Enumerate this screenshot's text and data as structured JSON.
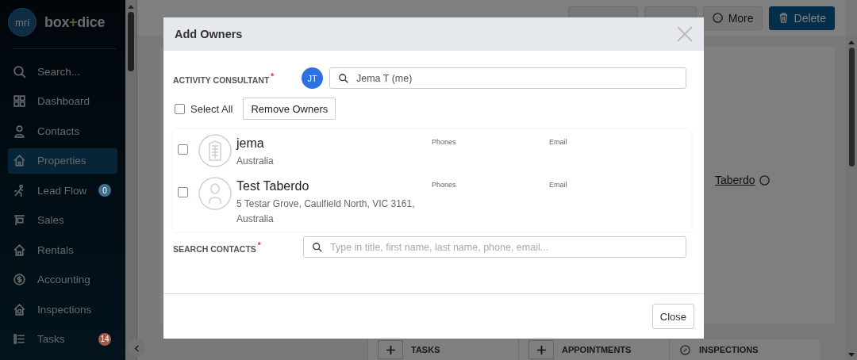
{
  "sidebar": {
    "logo": {
      "mark": "mri",
      "name_parts": [
        "box",
        "+",
        "dice"
      ]
    },
    "items": [
      {
        "label": "Search...",
        "selected": false
      },
      {
        "label": "Dashboard",
        "selected": false
      },
      {
        "label": "Contacts",
        "selected": false
      },
      {
        "label": "Properties",
        "selected": true
      },
      {
        "label": "Lead Flow",
        "selected": false,
        "badge": "0",
        "color": "#40708f"
      },
      {
        "label": "Sales",
        "selected": false
      },
      {
        "label": "Rentals",
        "selected": false
      },
      {
        "label": "Accounting",
        "selected": false
      },
      {
        "label": "Inspections",
        "selected": false
      },
      {
        "label": "Tasks",
        "selected": false,
        "badge": "14",
        "color": "#a35a4c"
      }
    ]
  },
  "page": {
    "actions": [
      {
        "kind": "covered"
      },
      {
        "kind": "covered"
      },
      {
        "label": "More",
        "kind": "outline"
      },
      {
        "label": "Delete",
        "kind": "primary"
      }
    ],
    "owner_link": "Taberdo",
    "sections": [
      {
        "label": "TASKS",
        "kind": "add"
      },
      {
        "label": "APPOINTMENTS",
        "kind": "add"
      },
      {
        "label": "INSPECTIONS",
        "kind": "icon"
      }
    ]
  },
  "dialog": {
    "title": "Add Owners",
    "consultant": {
      "label": "ACTIVITY CONSULTANT",
      "required_mark": "*",
      "initials": "JT",
      "value": "Jema T (me)"
    },
    "select_all": {
      "label": "Select All",
      "checked": false
    },
    "remove_button": "Remove Owners",
    "contacts": [
      {
        "kind": "company",
        "name": "jema",
        "address": "Australia",
        "checked": false,
        "phones_label": "Phones",
        "email_label": "Email"
      },
      {
        "kind": "person",
        "name": "Test Taberdo",
        "address": "5 Testar Grove, Caulfield North, VIC 3161, Australia",
        "checked": false,
        "phones_label": "Phones",
        "email_label": "Email"
      }
    ],
    "search": {
      "label": "SEARCH CONTACTS",
      "required_mark": "*",
      "placeholder": "Type in title, first name, last name, phone, email..."
    },
    "close_button": "Close"
  }
}
